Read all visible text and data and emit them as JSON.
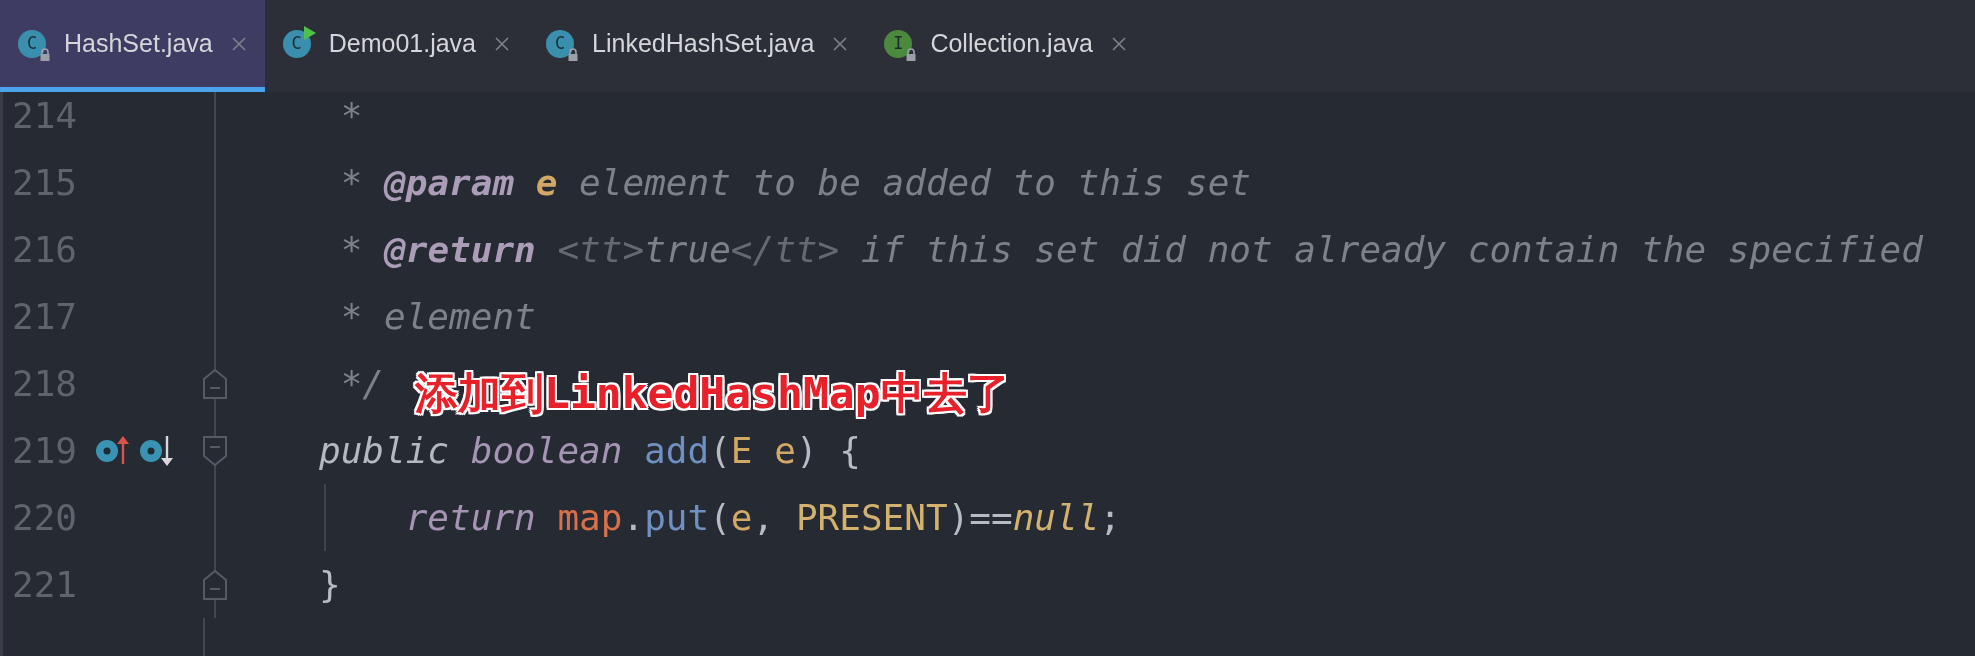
{
  "tabs": [
    {
      "label": "HashSet.java",
      "selected": true,
      "icon_letter": "C",
      "color": "#3b8fae",
      "locked": true,
      "runnable": false
    },
    {
      "label": "Demo01.java",
      "selected": false,
      "icon_letter": "C",
      "color": "#3b8fae",
      "locked": false,
      "runnable": true
    },
    {
      "label": "LinkedHashSet.java",
      "selected": false,
      "icon_letter": "C",
      "color": "#3b8fae",
      "locked": true,
      "runnable": false
    },
    {
      "label": "Collection.java",
      "selected": false,
      "icon_letter": "I",
      "color": "#4b8a3e",
      "locked": true,
      "runnable": false
    }
  ],
  "editor": {
    "lines": [
      {
        "number": "214",
        "kind": "plain",
        "tokens": [
          {
            "text": " *",
            "kind": "comment"
          }
        ]
      },
      {
        "number": "215",
        "kind": "plain",
        "tokens": [
          {
            "text": " * ",
            "kind": "comment"
          },
          {
            "text": "@param",
            "kind": "doctag"
          },
          {
            "text": " e",
            "kind": "docparam"
          },
          {
            "text": " element to be added to this set",
            "kind": "comment"
          }
        ]
      },
      {
        "number": "216",
        "kind": "plain",
        "tokens": [
          {
            "text": " * ",
            "kind": "comment"
          },
          {
            "text": "@return",
            "kind": "doctag"
          },
          {
            "text": " <tt>",
            "kind": "htmltag"
          },
          {
            "text": "true",
            "kind": "comment"
          },
          {
            "text": "</tt>",
            "kind": "htmltag"
          },
          {
            "text": " if this set did not already contain the specified",
            "kind": "comment"
          }
        ]
      },
      {
        "number": "217",
        "kind": "plain",
        "tokens": [
          {
            "text": " * element",
            "kind": "comment"
          }
        ]
      },
      {
        "number": "218",
        "kind": "fold_end",
        "tokens": [
          {
            "text": " */",
            "kind": "comment"
          }
        ]
      },
      {
        "number": "219",
        "kind": "method",
        "tokens": [
          {
            "text": "public ",
            "kind": "modifier"
          },
          {
            "text": "boolean ",
            "kind": "keyword"
          },
          {
            "text": "add",
            "kind": "method"
          },
          {
            "text": "(",
            "kind": "punct"
          },
          {
            "text": "E ",
            "kind": "typeparam"
          },
          {
            "text": "e",
            "kind": "param"
          },
          {
            "text": ") {",
            "kind": "punct"
          }
        ]
      },
      {
        "number": "220",
        "kind": "body",
        "tokens": [
          {
            "text": "    return ",
            "kind": "keyword"
          },
          {
            "text": "map",
            "kind": "field"
          },
          {
            "text": ".",
            "kind": "punct"
          },
          {
            "text": "put",
            "kind": "method"
          },
          {
            "text": "(",
            "kind": "punct"
          },
          {
            "text": "e",
            "kind": "param"
          },
          {
            "text": ", ",
            "kind": "punct"
          },
          {
            "text": "PRESENT",
            "kind": "constant"
          },
          {
            "text": ")==",
            "kind": "punct"
          },
          {
            "text": "null",
            "kind": "literal"
          },
          {
            "text": ";",
            "kind": "punct"
          }
        ]
      },
      {
        "number": "221",
        "kind": "fold_end",
        "tokens": [
          {
            "text": "}",
            "kind": "punct"
          }
        ]
      }
    ]
  },
  "annotation": {
    "text": "添加到LinkedHashMap中去了"
  }
}
